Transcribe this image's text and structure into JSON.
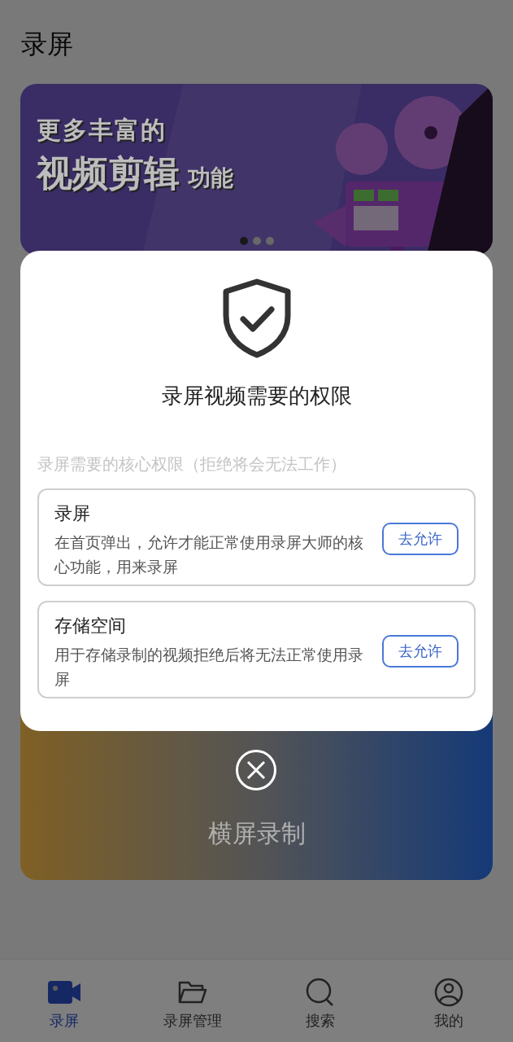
{
  "page_title": "录屏",
  "banner": {
    "headline": [
      "更多丰富的",
      "视频剪辑",
      "功能"
    ],
    "dots": [
      {
        "selected": true
      },
      {
        "selected": false
      },
      {
        "selected": false
      }
    ]
  },
  "record_card": {
    "label": "横屏录制"
  },
  "dialog": {
    "title": "录屏视频需要的权限",
    "subtitle": "录屏需要的核心权限（拒绝将会无法工作）",
    "permissions": [
      {
        "title": "录屏",
        "description": "在首页弹出，允许才能正常使用录屏大师的核心功能，用来录屏",
        "button": "去允许"
      },
      {
        "title": "存储空间",
        "description": "用于存储录制的视频拒绝后将无法正常使用录屏",
        "button": "去允许"
      }
    ]
  },
  "tabs": [
    {
      "label": "录屏",
      "kind": "camera",
      "selected": true
    },
    {
      "label": "录屏管理",
      "kind": "folder",
      "selected": false
    },
    {
      "label": "搜索",
      "kind": "search",
      "selected": false
    },
    {
      "label": "我的",
      "kind": "user",
      "selected": false
    }
  ]
}
